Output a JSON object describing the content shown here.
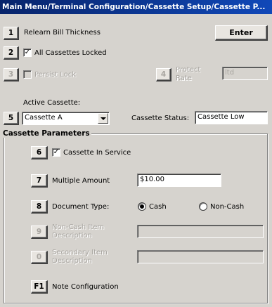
{
  "window": {
    "title": "Main Menu/Terminal Configuration/Cassette Setup/Cassette P..."
  },
  "rows": {
    "relearn": {
      "key": "1",
      "label": "Relearn Bill Thickness"
    },
    "enter_button": "Enter",
    "locked": {
      "key": "2",
      "label": "All Cassettes Locked",
      "checked": true,
      "check_mark": "✓"
    },
    "row3": {
      "key": "3",
      "label": "Persist Lock"
    },
    "row4": {
      "key": "4",
      "label_line1": "Protect",
      "label_line2": "Rate",
      "value": "ltd"
    },
    "active_cassette": {
      "label": "Active Cassette:",
      "key": "5",
      "value": "Cassette A"
    },
    "status": {
      "label": "Cassette Status:",
      "value": "Cassette Low"
    }
  },
  "params": {
    "title": "Cassette Parameters",
    "in_service": {
      "key": "6",
      "label": "Cassette In Service",
      "checked": true,
      "check_mark": "✓"
    },
    "multiple": {
      "key": "7",
      "label": "Multiple Amount",
      "value": "$10.00"
    },
    "doc_type": {
      "key": "8",
      "label": "Document Type:",
      "option_cash": "Cash",
      "option_noncash": "Non-Cash",
      "selected": "Cash"
    },
    "noncash_item": {
      "key": "9",
      "label_line1": "Non-Cash Item",
      "label_line2": "Description",
      "value": ""
    },
    "secondary": {
      "key": "0",
      "label_line1": "Secondary Item",
      "label_line2": "Description",
      "value": ""
    },
    "note_config": {
      "key": "F1",
      "label": "Note Configuration"
    }
  }
}
